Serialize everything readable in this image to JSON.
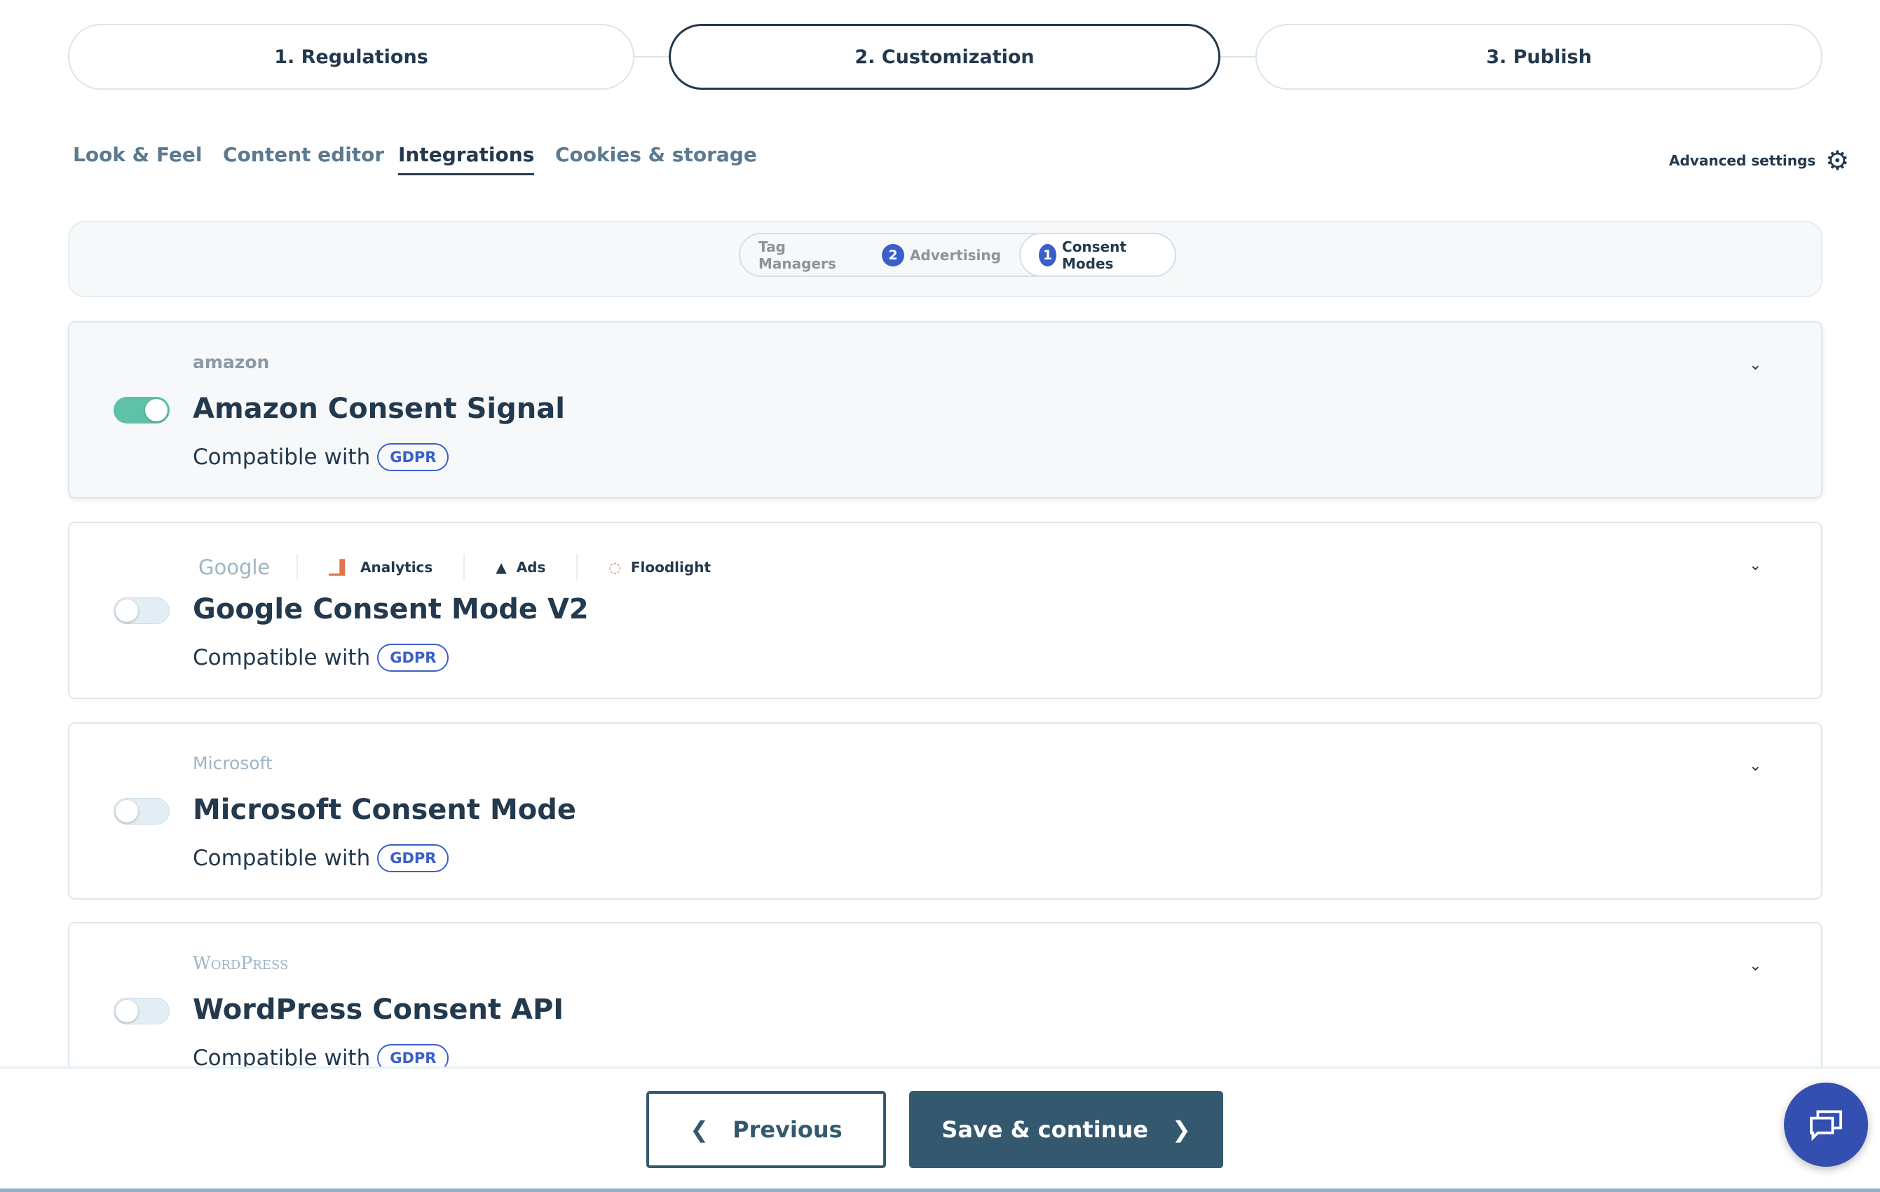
{
  "steps": [
    "1. Regulations",
    "2. Customization",
    "3. Publish"
  ],
  "tabs": [
    "Look & Feel",
    "Content editor",
    "Integrations",
    "Cookies & storage"
  ],
  "advanced_settings": "Advanced settings",
  "subtabs": {
    "tag_managers": "Tag Managers",
    "advertising": {
      "label": "Advertising",
      "count": "2"
    },
    "consent_modes": {
      "label": "Consent Modes",
      "count": "1"
    }
  },
  "cards": [
    {
      "logo": "amazon",
      "title": "Amazon Consent Signal",
      "compatible": "Compatible with",
      "badge": "GDPR",
      "enabled": true
    },
    {
      "logo": "Google",
      "services": [
        "Analytics",
        "Ads",
        "Floodlight"
      ],
      "title": "Google Consent Mode V2",
      "compatible": "Compatible with",
      "badge": "GDPR",
      "enabled": false
    },
    {
      "logo": "Microsoft",
      "title": "Microsoft Consent Mode",
      "compatible": "Compatible with",
      "badge": "GDPR",
      "enabled": false
    },
    {
      "logo": "WordPress",
      "title": "WordPress Consent API",
      "compatible": "Compatible with",
      "badge": "GDPR",
      "enabled": false
    }
  ],
  "footer": {
    "previous": "Previous",
    "save": "Save & continue"
  },
  "colors": {
    "primary": "#34596f",
    "accent": "#3a5fc9",
    "toggle_on": "#5ec1a8"
  }
}
